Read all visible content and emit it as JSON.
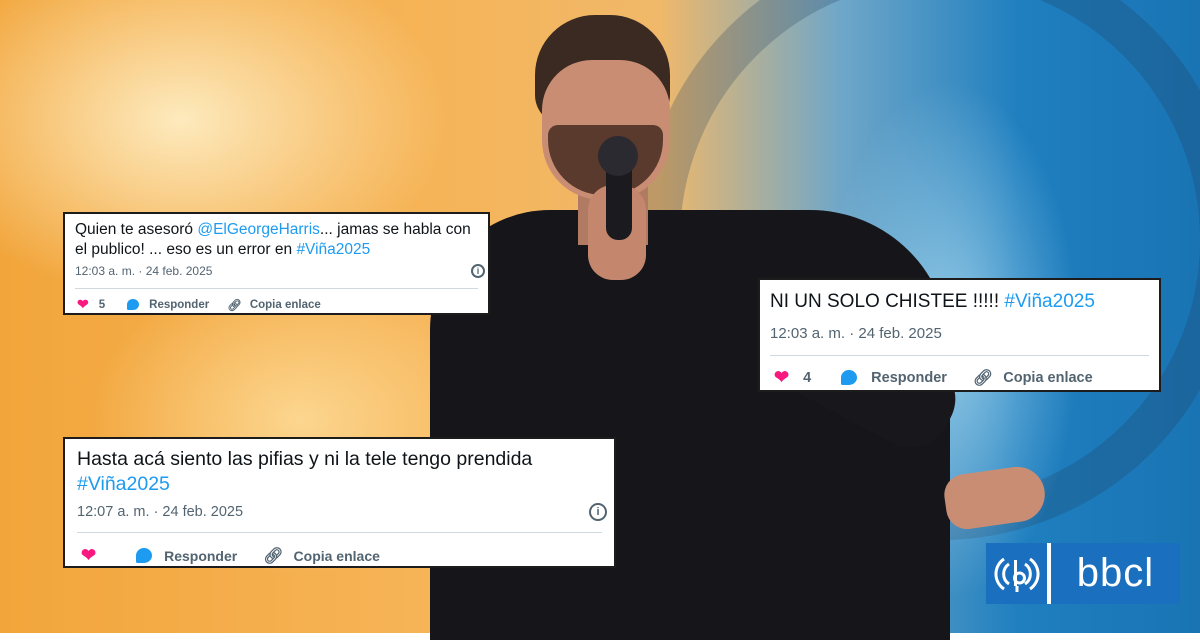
{
  "tweets": [
    {
      "text_prefix": "Quien te asesoró ",
      "mention": "@ElGeorgeHarris",
      "text_middle": "...  jamas se habla con\nel publico! ... eso es un error en ",
      "hashtag": "#Viña2025",
      "timestamp": "12:03 a. m. · 24 feb. 2025",
      "likes": "5",
      "reply_label": "Responder",
      "copy_label": "Copia enlace"
    },
    {
      "text": "NI UN SOLO CHISTEE !!!!!  ",
      "hashtag": "#Viña2025",
      "timestamp": "12:03 a. m. · 24 feb. 2025",
      "likes": "4",
      "reply_label": "Responder",
      "copy_label": "Copia enlace"
    },
    {
      "text": "Hasta acá siento las pifias y ni la tele tengo prendida\n",
      "hashtag": "#Viña2025",
      "timestamp": "12:07 a. m. · 24 feb. 2025",
      "reply_label": "Responder",
      "copy_label": "Copia enlace"
    }
  ],
  "logo": {
    "text": "bbcl",
    "icon": "radio-bio-bio-icon"
  },
  "colors": {
    "link": "#1d9bf0",
    "like": "#f91880",
    "brand": "#1b6fbf"
  },
  "icons": {
    "like": "heart-icon",
    "reply": "speech-bubble-icon",
    "copy": "link-icon",
    "info": "info-icon"
  }
}
